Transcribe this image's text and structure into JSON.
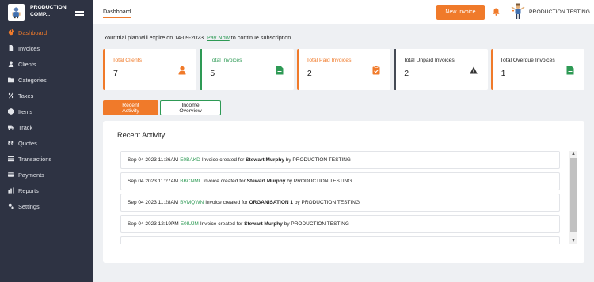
{
  "brand": {
    "name": "PRODUCTION COMP..."
  },
  "sidebar": {
    "items": [
      {
        "label": "Dashboard",
        "icon": "dashboard-icon",
        "active": true
      },
      {
        "label": "Invoices",
        "icon": "invoice-icon"
      },
      {
        "label": "Clients",
        "icon": "user-icon"
      },
      {
        "label": "Categories",
        "icon": "folder-icon"
      },
      {
        "label": "Taxes",
        "icon": "percent-icon"
      },
      {
        "label": "Items",
        "icon": "box-icon"
      },
      {
        "label": "Track",
        "icon": "truck-icon"
      },
      {
        "label": "Quotes",
        "icon": "quote-icon"
      },
      {
        "label": "Transactions",
        "icon": "transactions-icon"
      },
      {
        "label": "Payments",
        "icon": "payment-icon"
      },
      {
        "label": "Reports",
        "icon": "reports-icon"
      },
      {
        "label": "Settings",
        "icon": "settings-icon"
      }
    ]
  },
  "header": {
    "breadcrumb": "Dashboard",
    "new_invoice_label": "New Invoice",
    "username": "PRODUCTION TESTING"
  },
  "trial": {
    "prefix": "Your trial plan will expire on 14-09-2023.",
    "link": "Pay Now",
    "suffix": "to continue subscription"
  },
  "cards": [
    {
      "label": "Total Clients",
      "value": "7",
      "color": "#f07a2a",
      "icon": "user-icon"
    },
    {
      "label": "Total Invoices",
      "value": "5",
      "color": "#2e9a55",
      "icon": "file-icon"
    },
    {
      "label": "Total Paid Invoices",
      "value": "2",
      "color": "#f07a2a",
      "icon": "clipboard-check-icon"
    },
    {
      "label": "Total Unpaid Invoices",
      "value": "2",
      "color": "#444a55",
      "icon": "warning-icon"
    },
    {
      "label": "Total Overdue Invoices",
      "value": "1",
      "color": "#f07a2a",
      "icon": "file-icon"
    }
  ],
  "tabs": {
    "recent": "Recent Activity",
    "income": "Income Overview"
  },
  "activity": {
    "title": "Recent Activity",
    "rows": [
      {
        "time": "Sep 04 2023 11:26AM",
        "code": "E0BAKD",
        "mid": "Invoice created for",
        "who": "Stewart Murphy",
        "by": "by PRODUCTION TESTING"
      },
      {
        "time": "Sep 04 2023 11:27AM",
        "code": "BBCNML",
        "mid": "Invoice created for",
        "who": "Stewart Murphy",
        "by": "by PRODUCTION TESTING"
      },
      {
        "time": "Sep 04 2023 11:28AM",
        "code": "BVMQWN",
        "mid": "Invoice created for",
        "who": "ORGANISATION 1",
        "by": "by PRODUCTION TESTING"
      },
      {
        "time": "Sep 04 2023 12:19PM",
        "code": "E0IUJM",
        "mid": "Invoice created for",
        "who": "Stewart Murphy",
        "by": "by PRODUCTION TESTING"
      },
      {
        "time": "",
        "code": "",
        "mid": "",
        "who": "",
        "by": ""
      }
    ]
  },
  "colors": {
    "accent": "#f07a2a",
    "green": "#2e9a55",
    "sidebar": "#2e3343"
  }
}
